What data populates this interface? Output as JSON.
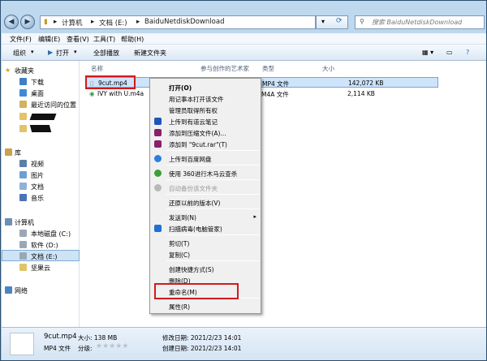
{
  "window": {
    "breadcrumb": [
      "计算机",
      "文档 (E:)",
      "BaiduNetdiskDownload"
    ],
    "search_placeholder": "搜索 BaiduNetdiskDownload"
  },
  "menubar": [
    "文件(F)",
    "编辑(E)",
    "查看(V)",
    "工具(T)",
    "帮助(H)"
  ],
  "toolbar": [
    "组织",
    "打开",
    "全部播放",
    "新建文件夹"
  ],
  "nav": {
    "favorites": "收藏夹",
    "favorites_items": [
      "下载",
      "桌面",
      "最近访问的位置"
    ],
    "library": "库",
    "library_items": [
      "视频",
      "图片",
      "文档",
      "音乐"
    ],
    "computer": "计算机",
    "computer_items": [
      "本地磁盘 (C:)",
      "软件 (D:)",
      "文档 (E:)",
      "坚果云"
    ],
    "network": "网络"
  },
  "columns": [
    "名称",
    "参与创作的艺术家",
    "类型",
    "大小"
  ],
  "files": [
    {
      "name": "9cut.mp4",
      "type": "MP4 文件",
      "size": "142,072 KB"
    },
    {
      "name": "IVY with U.m4a",
      "type": "M4A 文件",
      "size": "2,114 KB"
    }
  ],
  "context_menu": {
    "open": "打开(O)",
    "notepad": "用记事本打开该文件",
    "takeown": "管理员取得所有权",
    "youdao": "上传到有道云笔记",
    "add_archive": "添加到压缩文件(A)...",
    "add_rar": "添加到 \"9cut.rar\"(T)",
    "baidu": "上传到百度网盘",
    "scan360": "使用 360进行木马云查杀",
    "backup": "自动备份该文件夹",
    "restore": "还原以前的版本(V)",
    "sendto": "发送到(N)",
    "scan_mgr": "扫描病毒(电脑管家)",
    "cut": "剪切(T)",
    "copy": "复制(C)",
    "shortcut": "创建快捷方式(S)",
    "delete": "删除(D)",
    "rename": "重命名(M)",
    "properties": "属性(R)"
  },
  "status": {
    "filename": "9cut.mp4",
    "size": "大小: 138 MB",
    "modified": "修改日期: 2021/2/23 14:01",
    "filetype": "MP4 文件",
    "rating_label": "分级:",
    "created": "创建日期: 2021/2/23 14:01",
    "rating_value": 0
  },
  "colors": {
    "highlight": "#d21a1a",
    "selection": "#cde4fb"
  }
}
